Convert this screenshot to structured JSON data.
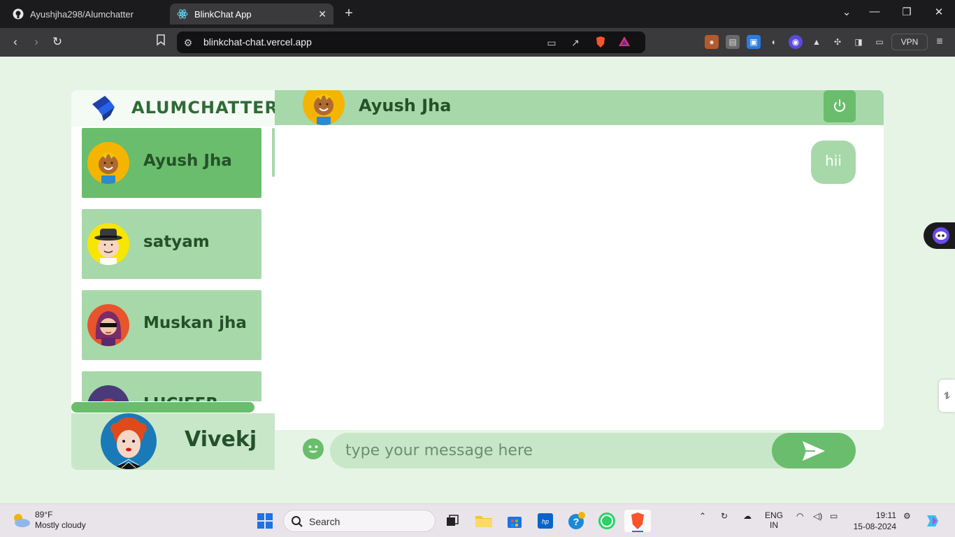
{
  "browser": {
    "tabs": [
      {
        "label": "Ayushjha298/Alumchatter",
        "icon": "github-icon"
      },
      {
        "label": "BlinkChat App",
        "icon": "react-icon",
        "active": true
      }
    ],
    "url": "blinkchat-chat.vercel.app",
    "vpn_label": "VPN"
  },
  "app": {
    "brand": "ALUMCHATTER",
    "contacts": [
      {
        "name": "Ayush Jha",
        "active": true
      },
      {
        "name": "satyam"
      },
      {
        "name": "Muskan jha"
      },
      {
        "name": "LUCIFER"
      }
    ],
    "current_user": "Vivekj",
    "chat": {
      "header_name": "Ayush Jha",
      "messages": [
        {
          "text": "hii",
          "direction": "outgoing"
        }
      ],
      "input_placeholder": "type your message here"
    },
    "colors": {
      "accent": "#6abd6c",
      "light": "#a7d8a9",
      "pale": "#c8e7c9",
      "text": "#25512a"
    }
  },
  "taskbar": {
    "weather_temp": "89°F",
    "weather_desc": "Mostly cloudy",
    "search_label": "Search",
    "lang_top": "ENG",
    "lang_bottom": "IN",
    "time": "19:11",
    "date": "15-08-2024"
  }
}
